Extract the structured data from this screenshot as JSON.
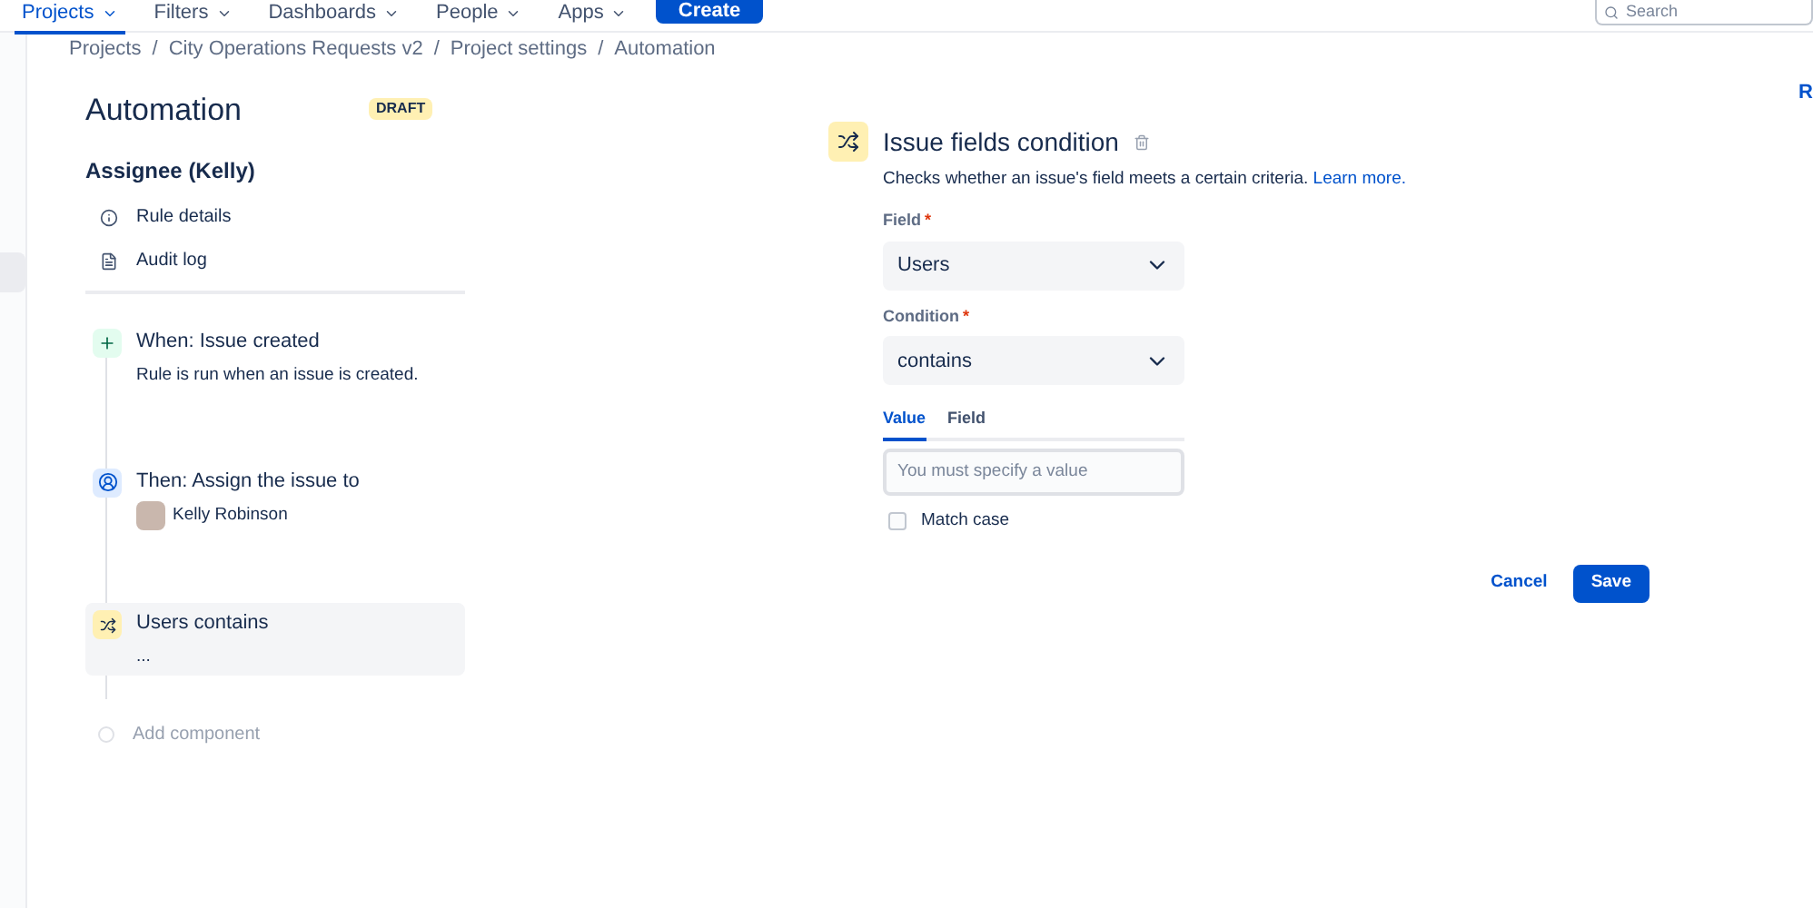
{
  "nav": {
    "items": [
      {
        "label": "Projects",
        "selected": true
      },
      {
        "label": "Filters",
        "selected": false
      },
      {
        "label": "Dashboards",
        "selected": false
      },
      {
        "label": "People",
        "selected": false
      },
      {
        "label": "Apps",
        "selected": false
      }
    ],
    "create": "Create",
    "search": {
      "placeholder": "Search"
    }
  },
  "breadcrumb_separator": "/",
  "breadcrumbs": [
    "Projects",
    "City Operations Requests v2",
    "Project settings",
    "Automation"
  ],
  "title": "Automation",
  "badge": "DRAFT",
  "corner_text": "R",
  "rule": {
    "name": "Assignee (Kelly)",
    "links": [
      {
        "kind": "info",
        "label": "Rule details"
      },
      {
        "kind": "log",
        "label": "Audit log"
      }
    ],
    "steps": [
      {
        "kind": "trigger",
        "title": "When: Issue created",
        "detail": "Rule is run when an issue is created.",
        "selected": false
      },
      {
        "kind": "action",
        "title": "Then: Assign the issue to",
        "person": "Kelly Robinson",
        "selected": false
      },
      {
        "kind": "condition",
        "title": "Users contains",
        "detail": "...",
        "selected": true
      }
    ],
    "add": "Add component"
  },
  "panel": {
    "title": "Issue fields condition",
    "description": "Checks whether an issue's field meets a certain criteria.",
    "link": "Learn more.",
    "field": {
      "label": "Field",
      "required_mark": "*",
      "value": "Users"
    },
    "condition": {
      "label": "Condition",
      "required_mark": "*",
      "value": "contains"
    },
    "tabs": [
      {
        "label": "Value",
        "selected": true
      },
      {
        "label": "Field",
        "selected": false
      }
    ],
    "value_input": {
      "placeholder": "You must specify a value"
    },
    "match_case": {
      "label": "Match case",
      "checked": false
    },
    "cancel": "Cancel",
    "save": "Save"
  }
}
